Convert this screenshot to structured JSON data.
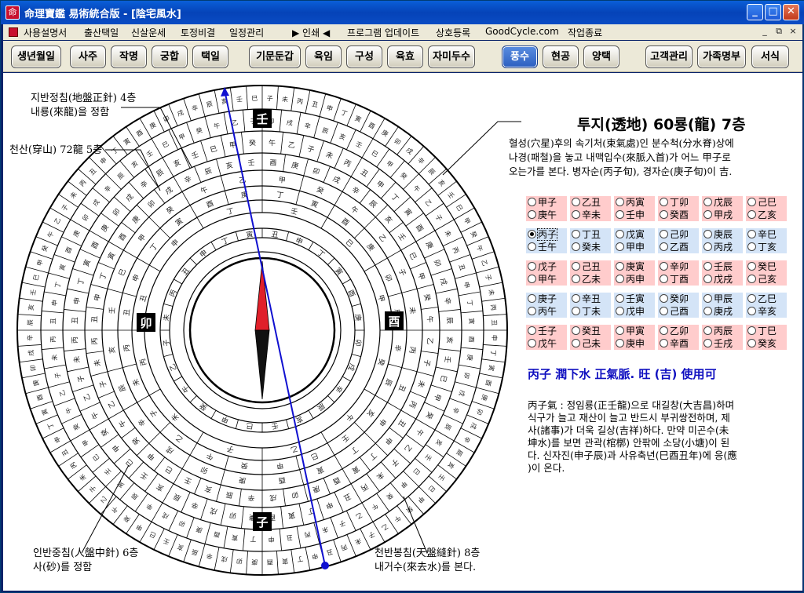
{
  "window": {
    "app_icon_text": "命",
    "title": "命理寶鑑 易術統合版 - [陰宅風水]",
    "minimize_label": "_",
    "maximize_label": "□",
    "close_label": "✕"
  },
  "menu": {
    "items": [
      "사용설명서",
      "출산택일",
      "신살운세",
      "토정비결",
      "일정관리",
      "▶ 인쇄 ◀",
      "프로그램 업데이트",
      "상호등록",
      "GoodCycle.com",
      "작업종료"
    ],
    "mdi_min": "_",
    "mdi_restore": "⧉",
    "mdi_close": "×"
  },
  "toolbar": {
    "buttons": [
      "생년월일",
      "사주",
      "작명",
      "궁합",
      "택일",
      "기문둔갑",
      "육임",
      "구성",
      "육효",
      "자미두수",
      "풍수",
      "현공",
      "양택",
      "고객관리",
      "가족명부",
      "서식"
    ],
    "active": "풍수"
  },
  "compass": {
    "notes": {
      "top_left_1": "지반정침(地盤正針) 4층",
      "top_left_2": "내룡(來龍)을 정함",
      "left_1": "천산(穿山) 72龍 5층",
      "bottom_left_1": "인반중침(人盤中針) 6층",
      "bottom_left_2": "사(砂)를 정함",
      "bottom_right_1": "천반봉침(天盤縫針) 8층",
      "bottom_right_2": "내거수(來去水)를 본다."
    },
    "center_chars": {
      "top": "壬",
      "top2": "子",
      "bottom": "子",
      "left": "卯",
      "right": "酉"
    }
  },
  "info": {
    "title": "투지(透地) 60룡(龍) 7층",
    "desc_lines": [
      "혈성(穴星)후의 속기처(束氣處)인 분수척(分水脊)상에",
      "나경(패철)을 놓고 내맥입수(來脈入首)가 어느 甲子로",
      "오는가를 본다. 병자순(丙子旬), 경자순(庚子旬)이 吉."
    ]
  },
  "radio_groups": [
    {
      "color": "pink",
      "row1": [
        "甲子",
        "乙丑",
        "丙寅",
        "丁卯",
        "戊辰",
        "己巳"
      ],
      "row2": [
        "庚午",
        "辛未",
        "壬申",
        "癸酉",
        "甲戌",
        "乙亥"
      ]
    },
    {
      "color": "blue",
      "row1": [
        "丙子",
        "丁丑",
        "戊寅",
        "己卯",
        "庚辰",
        "辛巳"
      ],
      "row2": [
        "壬午",
        "癸未",
        "甲申",
        "乙酉",
        "丙戌",
        "丁亥"
      ]
    },
    {
      "color": "pink",
      "row1": [
        "戊子",
        "己丑",
        "庚寅",
        "辛卯",
        "壬辰",
        "癸巳"
      ],
      "row2": [
        "甲午",
        "乙未",
        "丙申",
        "丁酉",
        "戊戌",
        "己亥"
      ]
    },
    {
      "color": "blue",
      "row1": [
        "庚子",
        "辛丑",
        "壬寅",
        "癸卯",
        "甲辰",
        "乙巳"
      ],
      "row2": [
        "丙午",
        "丁未",
        "戊申",
        "己酉",
        "庚戌",
        "辛亥"
      ]
    },
    {
      "color": "pink",
      "row1": [
        "壬子",
        "癸丑",
        "甲寅",
        "乙卯",
        "丙辰",
        "丁巳"
      ],
      "row2": [
        "戊午",
        "己未",
        "庚申",
        "辛酉",
        "壬戌",
        "癸亥"
      ]
    }
  ],
  "selected": "丙子",
  "result": {
    "headline": "丙子  潤下水  正氣脈.  旺  (吉)  使用可",
    "lines": [
      "丙子氣 : 정임룡(正壬龍)으로 대길창(大吉昌)하며",
      "식구가 늘고 재산이 늘고 반드시 부귀쌍전하며, 제",
      "사(諸事)가 더욱 길상(吉祥)하다. 만약 미곤수(未",
      "坤水)를 보면 관곽(棺槨) 안팎에 소당(小塘)이 된",
      "다. 신자진(申子辰)과 사유축년(巳酉丑年)에 응(應",
      ")이 온다."
    ]
  },
  "colors": {
    "accent_blue": "#1010c0",
    "needle_red": "#e0202a",
    "pink_cell": "#ffcccc",
    "blue_cell": "#d4e4f7"
  }
}
